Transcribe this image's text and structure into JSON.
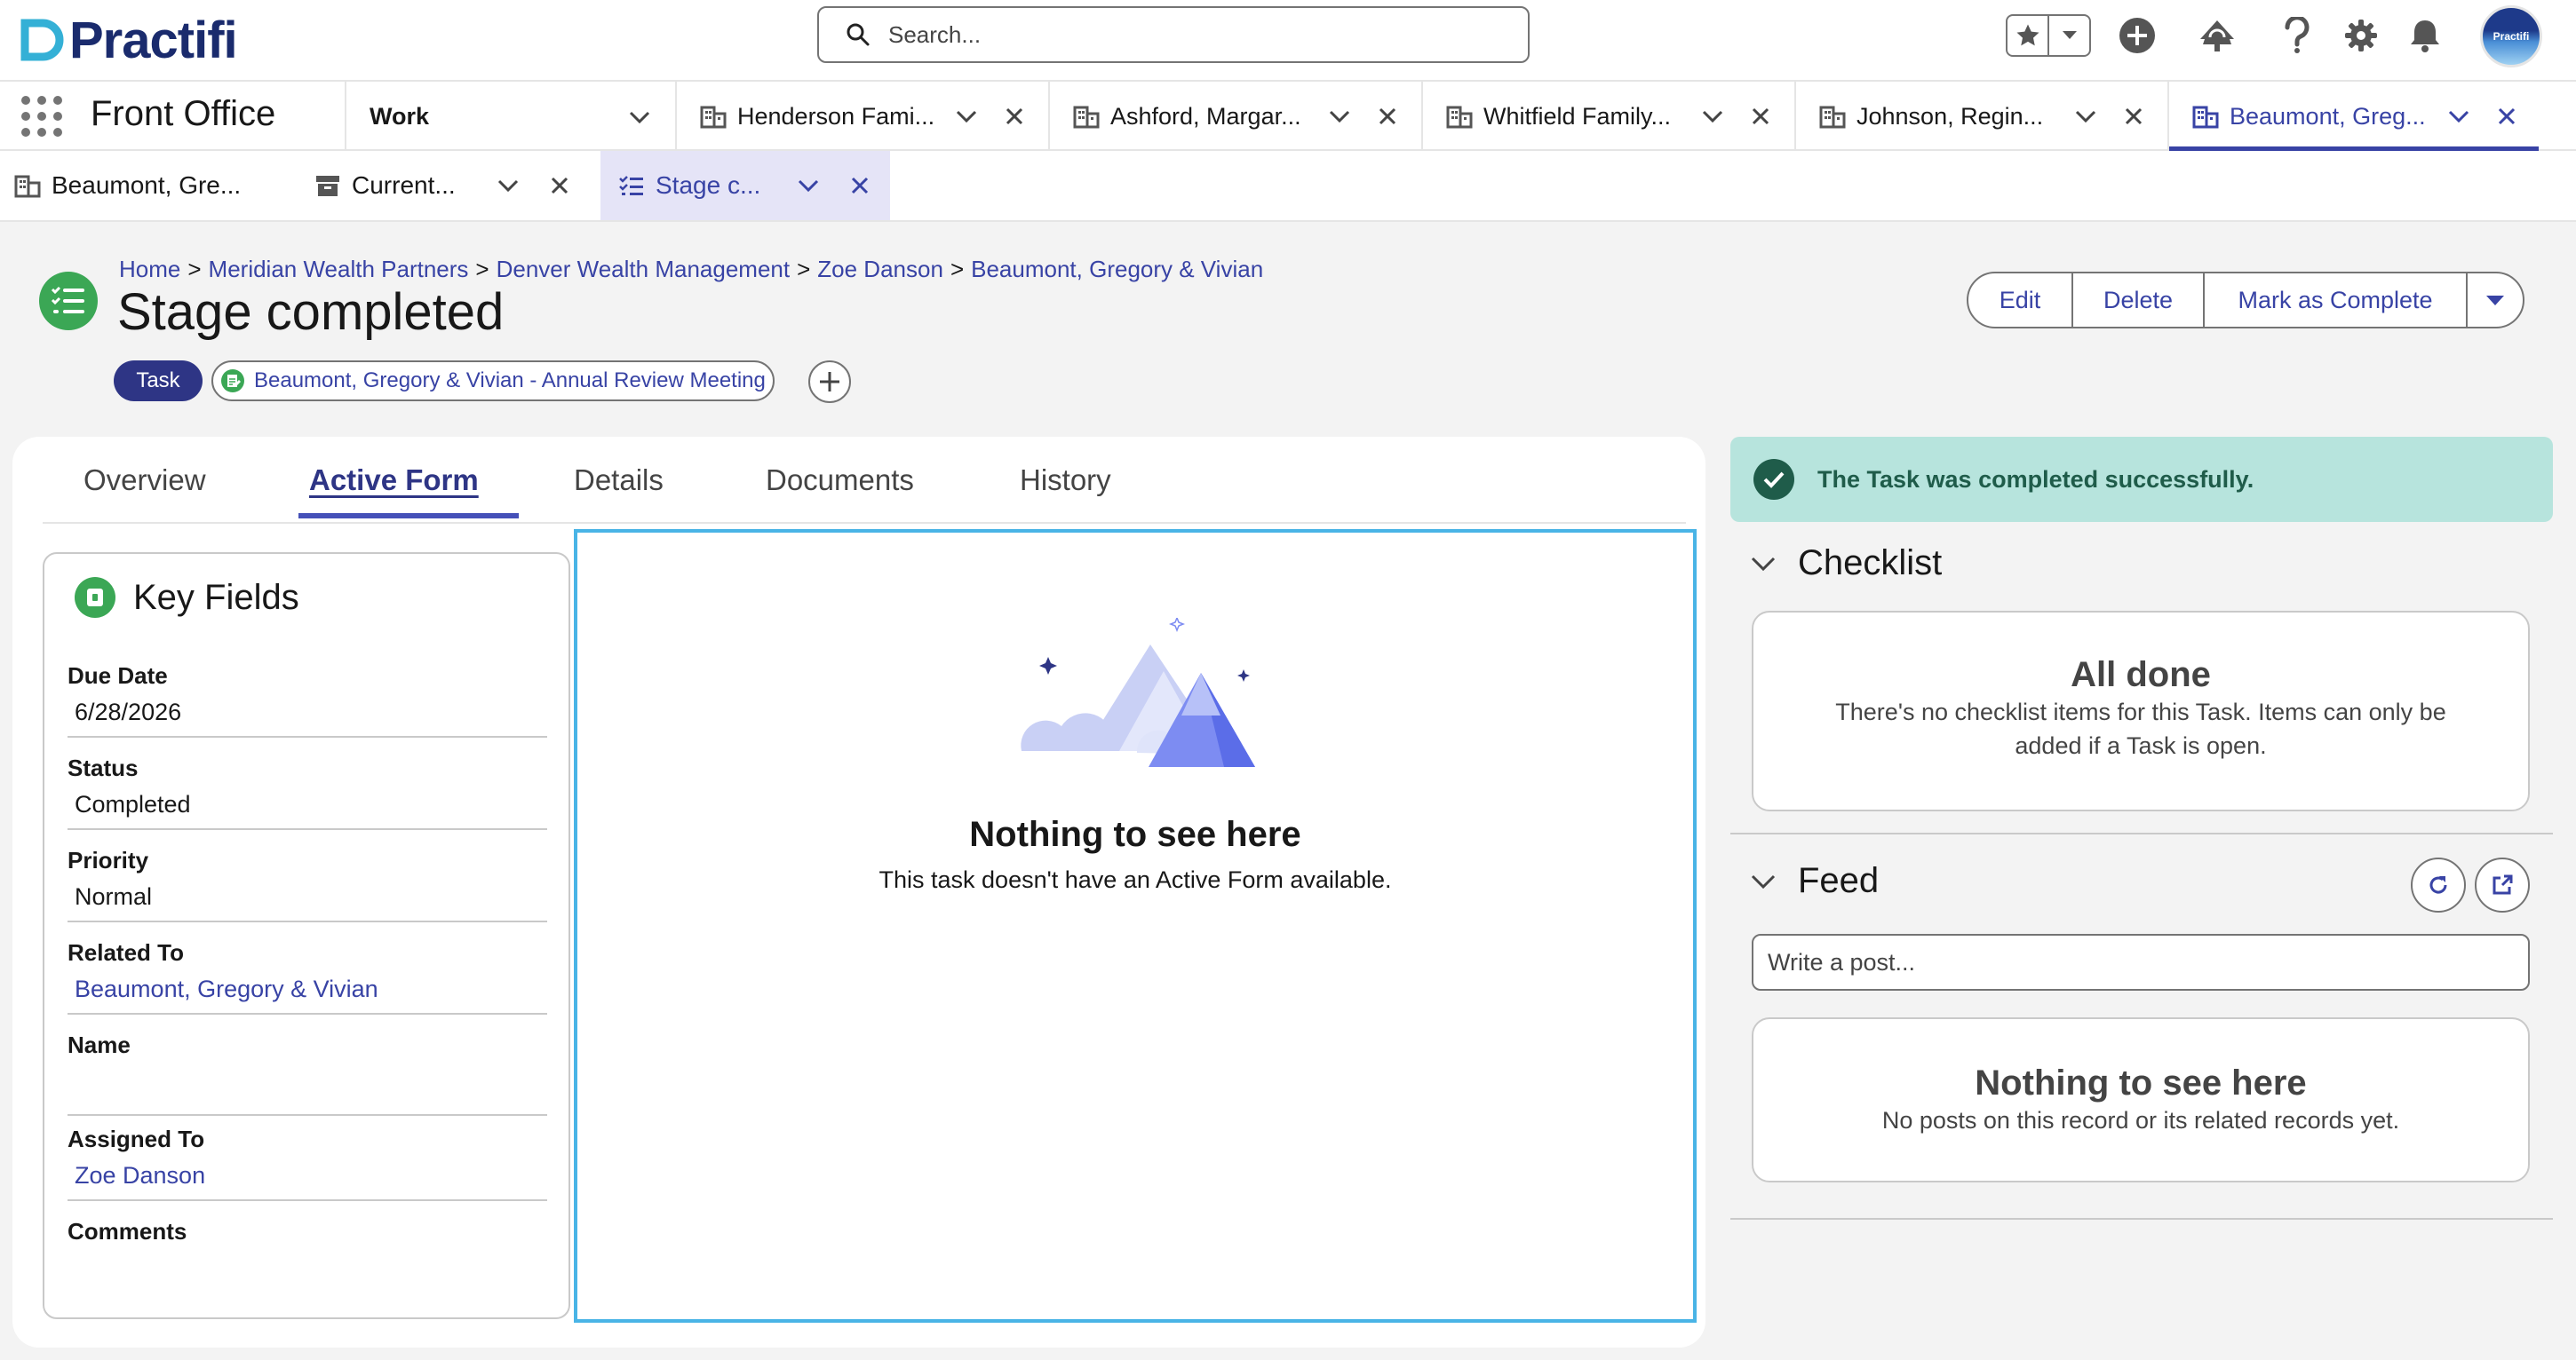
{
  "header": {
    "logo_text": "Practifi",
    "search_placeholder": "Search...",
    "avatar_text": "Practifi"
  },
  "nav": {
    "app_name": "Front Office",
    "work_label": "Work",
    "tabs": [
      {
        "label": "Henderson Fami..."
      },
      {
        "label": "Ashford, Margar..."
      },
      {
        "label": "Whitfield Family..."
      },
      {
        "label": "Johnson, Regin..."
      },
      {
        "label": "Beaumont, Greg..."
      }
    ]
  },
  "subtabs": [
    {
      "label": "Beaumont, Gre..."
    },
    {
      "label": "Current..."
    },
    {
      "label": "Stage c..."
    }
  ],
  "breadcrumb": {
    "sep": ">",
    "items": [
      "Home",
      "Meridian Wealth Partners",
      "Denver Wealth Management",
      "Zoe Danson",
      "Beaumont, Gregory & Vivian"
    ]
  },
  "record": {
    "title": "Stage completed",
    "type_pill": "Task",
    "related_pill": "Beaumont, Gregory & Vivian - Annual Review Meeting"
  },
  "actions": {
    "edit": "Edit",
    "delete": "Delete",
    "complete": "Mark as Complete"
  },
  "tabs": {
    "overview": "Overview",
    "active_form": "Active Form",
    "details": "Details",
    "documents": "Documents",
    "history": "History"
  },
  "key_fields": {
    "title": "Key Fields",
    "fields": [
      {
        "label": "Due Date",
        "value": "6/28/2026"
      },
      {
        "label": "Status",
        "value": "Completed"
      },
      {
        "label": "Priority",
        "value": "Normal"
      },
      {
        "label": "Related To",
        "value": "Beaumont, Gregory & Vivian"
      },
      {
        "label": "Name",
        "value": ""
      },
      {
        "label": "Assigned To",
        "value": "Zoe Danson"
      },
      {
        "label": "Comments",
        "value": ""
      }
    ]
  },
  "active_form": {
    "empty_title": "Nothing to see here",
    "empty_sub": "This task doesn't have an Active Form available."
  },
  "toast": {
    "message": "The Task was completed successfully."
  },
  "checklist": {
    "heading": "Checklist",
    "empty_title": "All done",
    "empty_line1": "There's no checklist items for this Task. Items can only be",
    "empty_line2": "added if a Task is open."
  },
  "feed": {
    "heading": "Feed",
    "post_placeholder": "Write a post...",
    "empty_title": "Nothing to see here",
    "empty_sub": "No posts on this record or its related records yet."
  },
  "colors": {
    "brand": "#3843a5",
    "record_icon": "#3ba755",
    "toast_bg": "#b7e4dd",
    "focus_border": "#49b4e6"
  },
  "icons": [
    "search-icon",
    "star-icon",
    "chevron-down-icon",
    "plus-circle-icon",
    "trailhead-icon",
    "help-icon",
    "gear-icon",
    "bell-icon",
    "app-launcher-icon",
    "building-icon",
    "close-icon",
    "archive-icon",
    "checklist-icon",
    "task-list-icon",
    "lock-icon",
    "check-circle-icon",
    "refresh-icon",
    "external-link-icon"
  ]
}
